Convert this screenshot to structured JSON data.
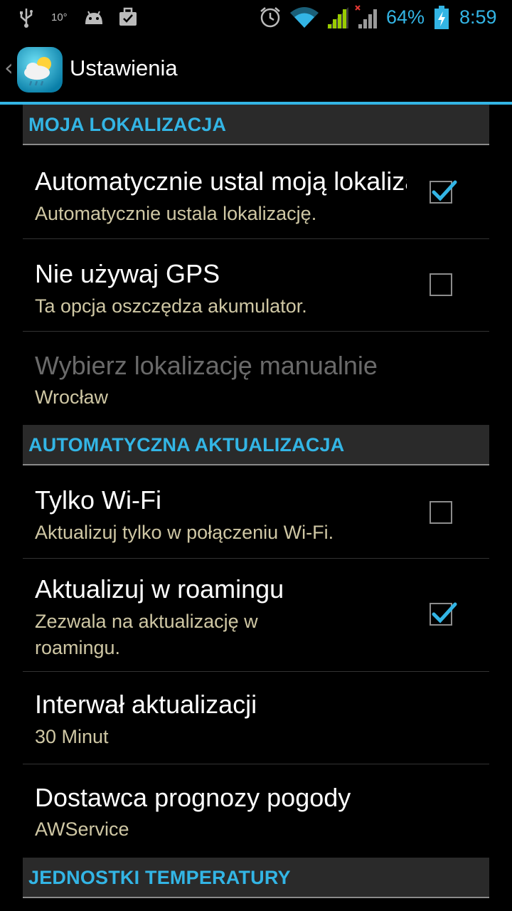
{
  "status_bar": {
    "temperature": "10°",
    "battery_percent": "64%",
    "time": "8:59",
    "icons": [
      "usb-icon",
      "weather-temp-icon",
      "android-icon",
      "briefcase-icon",
      "alarm-icon",
      "wifi-icon",
      "signal-icon",
      "signal-no-data-icon",
      "battery-charging-icon"
    ],
    "accent_color": "#33b5e5"
  },
  "action_bar": {
    "title": "Ustawienia",
    "back_icon": "chevron-left-icon",
    "app_icon": "weather-app-icon"
  },
  "sections": [
    {
      "header": "MOJA LOKALIZACJA",
      "items": [
        {
          "title": "Automatycznie ustal moją lokalizację",
          "summary": "Automatycznie ustala lokalizację.",
          "checked": true,
          "enabled": true
        },
        {
          "title": "Nie używaj GPS",
          "summary": "Ta opcja oszczędza akumulator.",
          "checked": false,
          "enabled": true
        },
        {
          "title": "Wybierz lokalizację manualnie",
          "summary": "Wrocław",
          "enabled": false
        }
      ]
    },
    {
      "header": "AUTOMATYCZNA AKTUALIZACJA",
      "items": [
        {
          "title": "Tylko Wi-Fi",
          "summary": "Aktualizuj tylko w połączeniu Wi-Fi.",
          "checked": false,
          "enabled": true
        },
        {
          "title": "Aktualizuj w roamingu",
          "summary_line1": "Zezwala na aktualizację w",
          "summary_line2": "roamingu.",
          "checked": true,
          "enabled": true
        },
        {
          "title": "Interwał aktualizacji",
          "summary": "30 Minut",
          "enabled": true
        },
        {
          "title": "Dostawca prognozy pogody",
          "summary": "AWService",
          "enabled": true
        }
      ]
    },
    {
      "header": "JEDNOSTKI TEMPERATURY",
      "items": []
    }
  ]
}
